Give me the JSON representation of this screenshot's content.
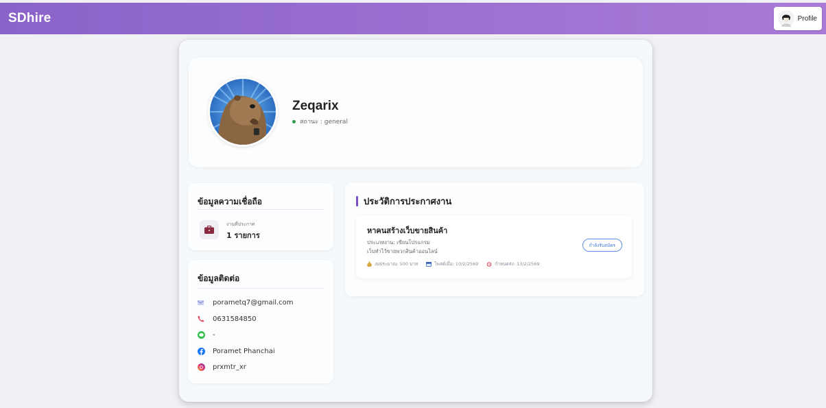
{
  "app": {
    "brand": "SDhire",
    "profile_label": "Profile"
  },
  "user": {
    "name": "Zeqarix",
    "status": "สถานะ : general"
  },
  "trust": {
    "title": "ข้อมูลความเชื่อถือ",
    "stat_caption": "งานที่ประกาศ",
    "stat_value": "1 รายการ"
  },
  "contact": {
    "title": "ข้อมูลติดต่อ",
    "items": [
      {
        "icon": "email-icon",
        "value": "porametq7@gmail.com"
      },
      {
        "icon": "phone-icon",
        "value": "0631584850"
      },
      {
        "icon": "line-icon",
        "value": "-"
      },
      {
        "icon": "facebook-icon",
        "value": "Poramet Phanchai"
      },
      {
        "icon": "instagram-icon",
        "value": "prxmtr_xr"
      }
    ]
  },
  "history": {
    "title": "ประวัติการประกาศงาน",
    "jobs": [
      {
        "title": "หาคนสร้างเว็บขายสินค้า",
        "type": "ประเภทงาน: เขียนโปรแกรม",
        "description": "เว็บทำไว้ขายพวกสินค้าออนไลน์",
        "budget": "งบประมาณ: 500 บาท",
        "posted": "โพสต์เมื่อ: 10/2/2569",
        "deadline": "กำหนดส่ง: 13/2/2569",
        "status": "กำลังรับสมัคร"
      }
    ]
  },
  "colors": {
    "header_start": "#8a63c9",
    "header_end": "#a97bd6",
    "accent": "#7b4fc8",
    "status_dot": "#2e9e4a",
    "badge": "#3f78d9"
  }
}
